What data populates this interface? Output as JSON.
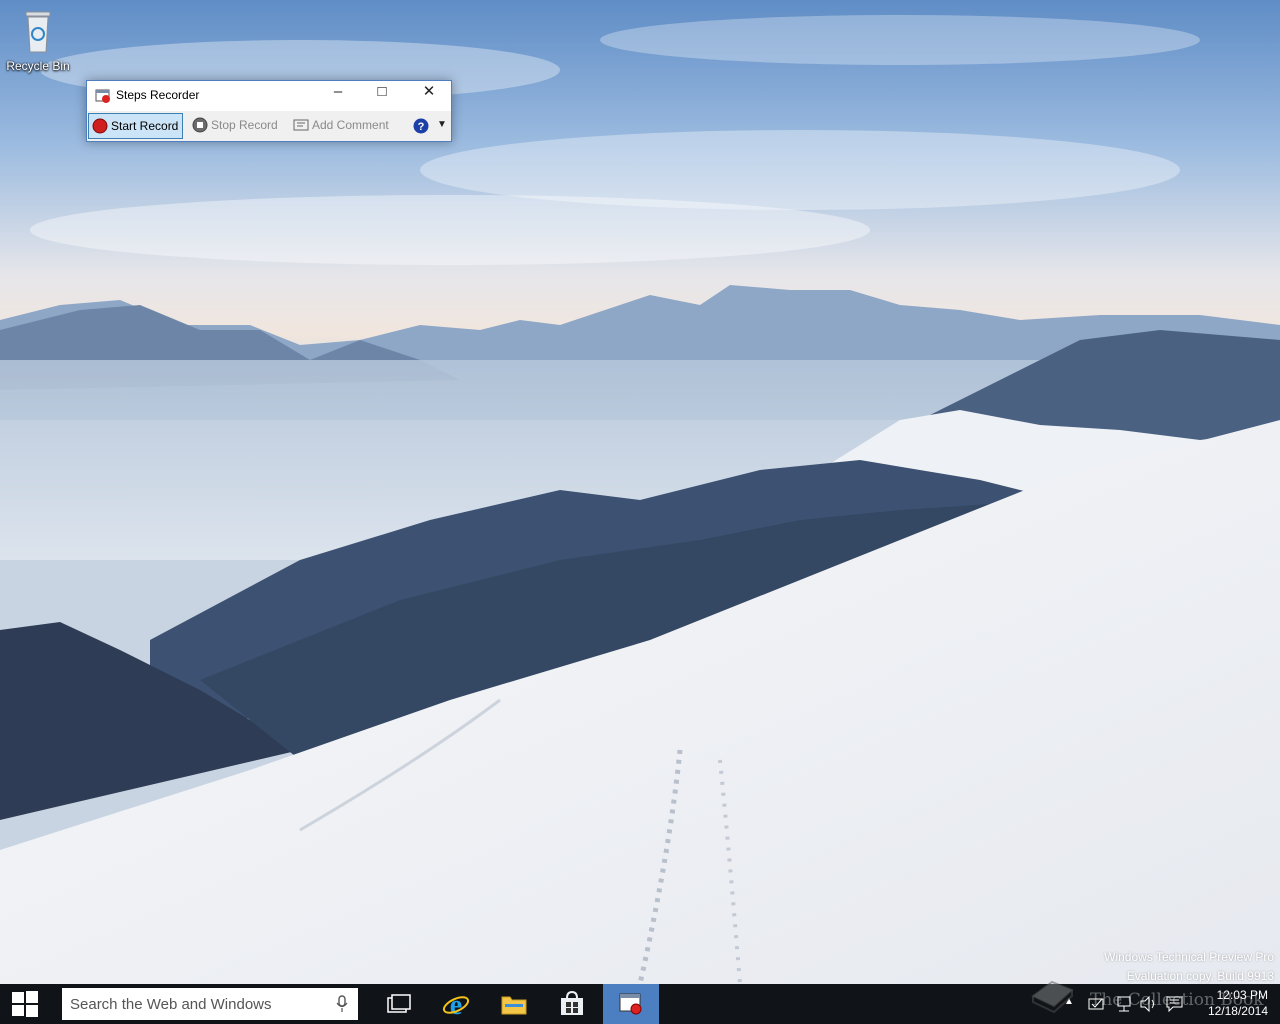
{
  "desktop": {
    "icons": [
      {
        "label": "Recycle Bin"
      }
    ],
    "watermark": {
      "line1": "Windows Technical Preview Pro",
      "line2": "Evaluation copy. Build 9913"
    },
    "brand_overlay": "The Collection Book"
  },
  "steps_recorder": {
    "title": "Steps Recorder",
    "buttons": {
      "start": "Start Record",
      "stop": "Stop Record",
      "comment": "Add Comment"
    },
    "accent": "#4f7fc0"
  },
  "taskbar": {
    "search_placeholder": "Search the Web and Windows",
    "apps": [
      "task-view",
      "internet-explorer",
      "file-explorer",
      "store",
      "steps-recorder"
    ],
    "clock": {
      "time": "12:03 PM",
      "date": "12/18/2014"
    }
  }
}
